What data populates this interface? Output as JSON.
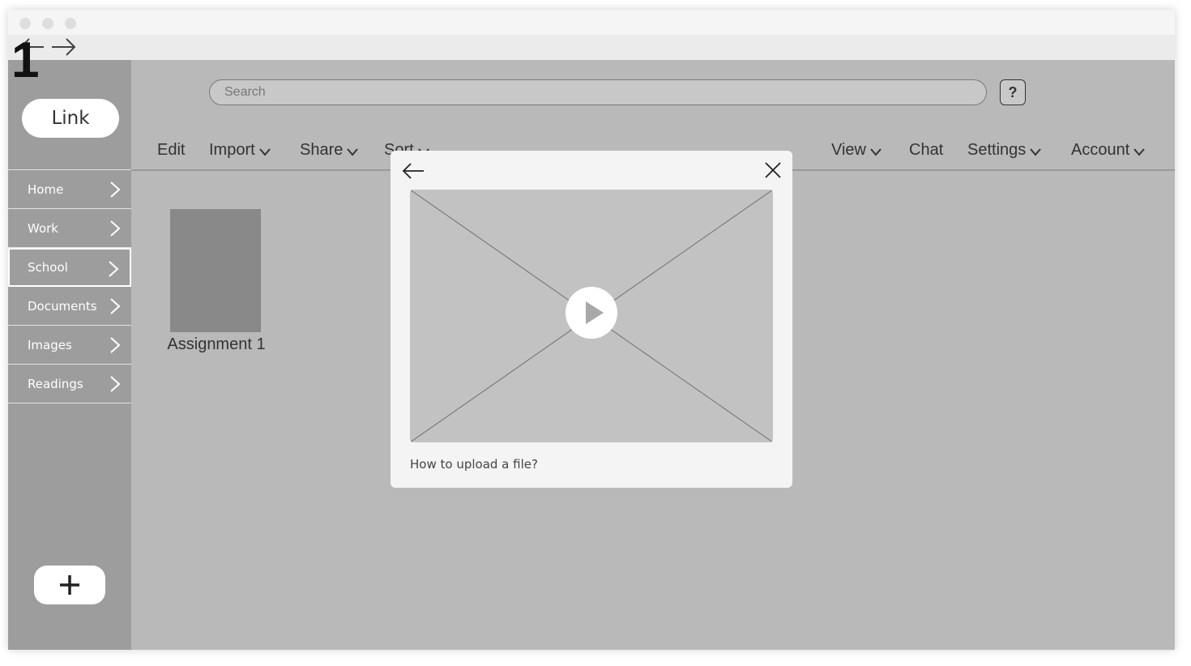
{
  "step": "1",
  "sidebar": {
    "link_label": "Link",
    "items": [
      {
        "label": "Home"
      },
      {
        "label": "Work"
      },
      {
        "label": "School"
      },
      {
        "label": "Documents"
      },
      {
        "label": "Images"
      },
      {
        "label": "Readings"
      }
    ],
    "active_item": "School",
    "add_icon": "plus-icon"
  },
  "search": {
    "placeholder": "Search"
  },
  "help_label": "?",
  "menu": {
    "edit": "Edit",
    "import": "Import",
    "share": "Share",
    "sort": "Sort",
    "view": "View",
    "chat": "Chat",
    "settings": "Settings",
    "account": "Account"
  },
  "files": [
    {
      "name": "Assignment 1"
    }
  ],
  "modal": {
    "caption": "How to upload a file?"
  },
  "colors": {
    "background": "#b9b9b9",
    "sidebar": "#9d9d9d",
    "thumbnail": "#898989",
    "modal": "#f4f4f4"
  }
}
